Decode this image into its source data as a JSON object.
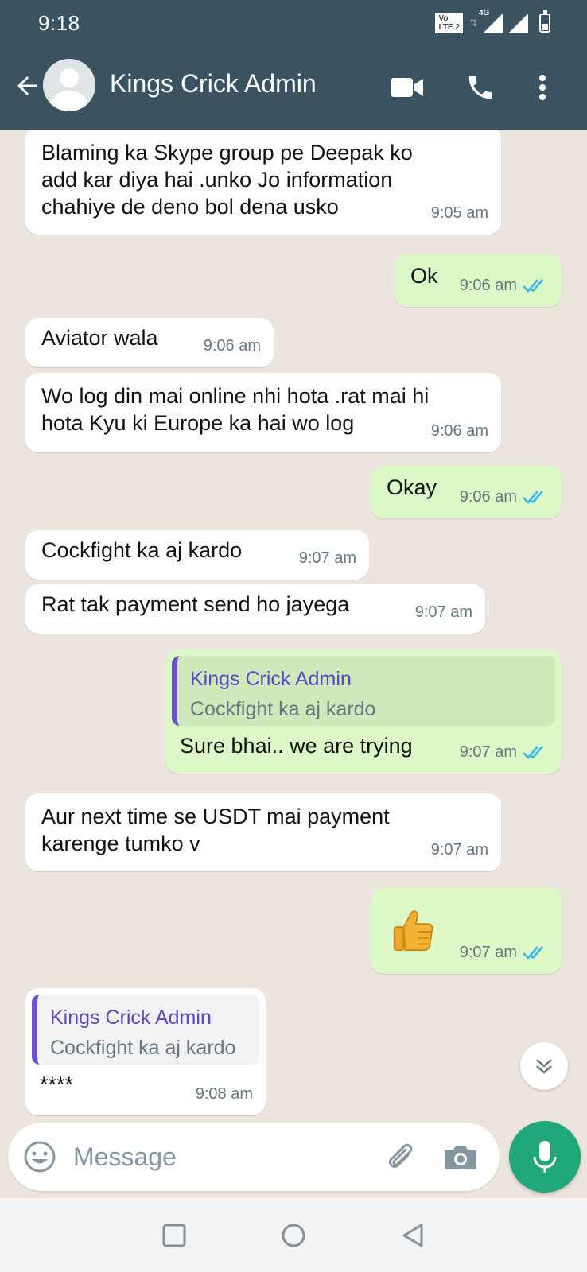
{
  "status_bar": {
    "time": "9:18",
    "volte": "Vo LTE 2",
    "network": "4G"
  },
  "header": {
    "contact_name": "Kings Crick Admin"
  },
  "icons": {
    "back": "arrow-left-icon",
    "video": "video-call-icon",
    "call": "phone-icon",
    "menu": "more-vert-icon",
    "emoji": "emoji-icon",
    "attach": "paperclip-icon",
    "camera": "camera-icon",
    "mic": "mic-icon",
    "scroll": "chevron-double-down-icon",
    "ticks": "double-check-icon"
  },
  "colors": {
    "header": "#3b5361",
    "incoming": "#ffffff",
    "outgoing": "#dcf8c6",
    "accent": "#1fa67a",
    "read_ticks": "#34b7f1",
    "quote_bar": "#6c4fd1"
  },
  "messages": [
    {
      "dir": "in",
      "text": "Blaming ka Skype group pe Deepak ko\nadd kar diya hai .unko Jo information\nchahiye de deno bol dena usko",
      "time": "9:05 am"
    },
    {
      "dir": "out",
      "text": "Ok",
      "time": "9:06 am",
      "read": true
    },
    {
      "dir": "in",
      "text": "Aviator wala",
      "time": "9:06 am"
    },
    {
      "dir": "in",
      "text": "Wo log din mai online nhi hota .rat mai hi\nhota Kyu ki Europe ka hai wo log",
      "time": "9:06 am"
    },
    {
      "dir": "out",
      "text": "Okay",
      "time": "9:06 am",
      "read": true
    },
    {
      "dir": "in",
      "text": "Cockfight ka aj kardo",
      "time": "9:07 am"
    },
    {
      "dir": "in",
      "text": "Rat tak payment send ho jayega",
      "time": "9:07 am"
    },
    {
      "dir": "out",
      "quote_author": "Kings Crick Admin",
      "quote_text": "Cockfight ka aj kardo",
      "text": "Sure bhai.. we are trying",
      "time": "9:07 am",
      "read": true
    },
    {
      "dir": "in",
      "text": "Aur next time se USDT mai payment\nkarenge tumko v",
      "time": "9:07 am"
    },
    {
      "dir": "out",
      "emoji": "thumbs-up",
      "time": "9:07 am",
      "read": true
    },
    {
      "dir": "in",
      "quote_author": "Kings Crick Admin",
      "quote_text": "Cockfight ka aj kardo",
      "text": "****",
      "time": "9:08 am"
    }
  ],
  "composer": {
    "placeholder": "Message"
  }
}
